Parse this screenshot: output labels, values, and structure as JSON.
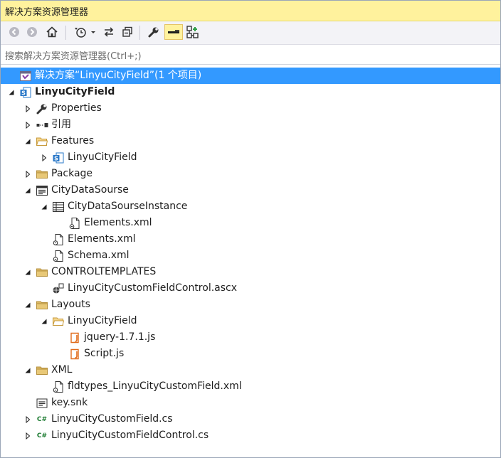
{
  "window": {
    "title": "解决方案资源管理器"
  },
  "toolbar": {
    "buttons": [
      {
        "icon": "back-icon"
      },
      {
        "icon": "forward-icon"
      },
      {
        "icon": "home-icon"
      },
      {
        "icon": "pending-changes-filter-icon"
      },
      {
        "icon": "sync-with-document-icon"
      },
      {
        "icon": "collapse-all-icon"
      },
      {
        "icon": "properties-wrench-icon"
      },
      {
        "icon": "preview-selected-items-icon"
      },
      {
        "icon": "class-diagram-icon"
      }
    ]
  },
  "search": {
    "placeholder": "搜索解决方案资源管理器(Ctrl+;)"
  },
  "colors": {
    "selection": "#3399ff",
    "title_bar": "#fff29d",
    "csharp_icon": "#1a7a2f",
    "js_icon": "#e06c1c"
  },
  "tree": [
    {
      "label": "解决方案“LinyuCityField”(1 个项目)",
      "icon": "solution-icon",
      "depth": 0,
      "arrow": "none",
      "selected": true
    },
    {
      "label": "LinyuCityField",
      "icon": "sharepoint-project-icon",
      "depth": 0,
      "arrow": "expanded",
      "bold": true
    },
    {
      "label": "Properties",
      "icon": "wrench-icon",
      "depth": 1,
      "arrow": "collapsed"
    },
    {
      "label": "引用",
      "icon": "references-icon",
      "depth": 1,
      "arrow": "collapsed"
    },
    {
      "label": "Features",
      "icon": "folder-open-icon",
      "depth": 1,
      "arrow": "expanded"
    },
    {
      "label": "LinyuCityField",
      "icon": "feature-icon",
      "depth": 2,
      "arrow": "collapsed"
    },
    {
      "label": "Package",
      "icon": "folder-icon",
      "depth": 1,
      "arrow": "collapsed"
    },
    {
      "label": "CityDataSourse",
      "icon": "list-definition-icon",
      "depth": 1,
      "arrow": "expanded"
    },
    {
      "label": "CityDataSourseInstance",
      "icon": "list-instance-icon",
      "depth": 2,
      "arrow": "expanded"
    },
    {
      "label": "Elements.xml",
      "icon": "xml-file-icon",
      "depth": 3,
      "arrow": "none"
    },
    {
      "label": "Elements.xml",
      "icon": "xml-file-icon",
      "depth": 2,
      "arrow": "none"
    },
    {
      "label": "Schema.xml",
      "icon": "xml-file-icon",
      "depth": 2,
      "arrow": "none"
    },
    {
      "label": "CONTROLTEMPLATES",
      "icon": "folder-icon",
      "depth": 1,
      "arrow": "expanded"
    },
    {
      "label": "LinyuCityCustomFieldControl.ascx",
      "icon": "user-control-icon",
      "depth": 2,
      "arrow": "none"
    },
    {
      "label": "Layouts",
      "icon": "folder-icon",
      "depth": 1,
      "arrow": "expanded"
    },
    {
      "label": "LinyuCityField",
      "icon": "folder-open-icon",
      "depth": 2,
      "arrow": "expanded"
    },
    {
      "label": "jquery-1.7.1.js",
      "icon": "js-file-icon",
      "depth": 3,
      "arrow": "none"
    },
    {
      "label": "Script.js",
      "icon": "js-file-icon",
      "depth": 3,
      "arrow": "none"
    },
    {
      "label": "XML",
      "icon": "folder-icon",
      "depth": 1,
      "arrow": "expanded"
    },
    {
      "label": "fldtypes_LinyuCityCustomField.xml",
      "icon": "xml-file-icon",
      "depth": 2,
      "arrow": "none"
    },
    {
      "label": "key.snk",
      "icon": "key-file-icon",
      "depth": 1,
      "arrow": "none"
    },
    {
      "label": "LinyuCityCustomField.cs",
      "icon": "csharp-file-icon",
      "depth": 1,
      "arrow": "collapsed",
      "icon_text": "C#"
    },
    {
      "label": "LinyuCityCustomFieldControl.cs",
      "icon": "csharp-file-icon",
      "depth": 1,
      "arrow": "collapsed",
      "icon_text": "C#"
    }
  ]
}
